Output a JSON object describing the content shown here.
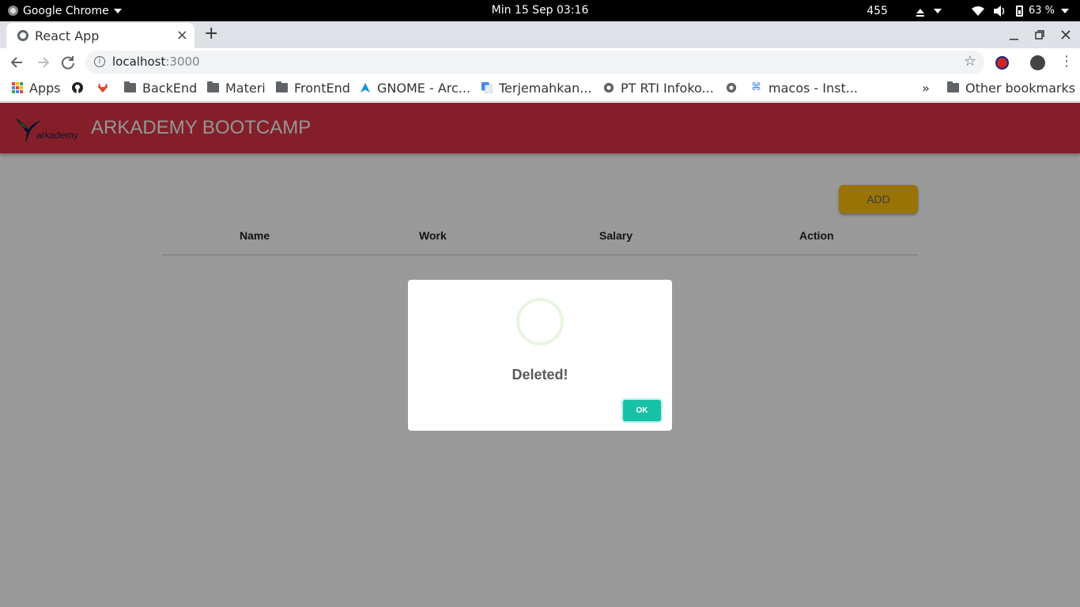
{
  "system_bar": {
    "app_name": "Google Chrome",
    "clock": "Min 15 Sep  03:16",
    "counter": "455",
    "battery": "63 %"
  },
  "browser": {
    "tab_title": "React App",
    "tab_close": "×",
    "new_tab": "+",
    "url_host": "localhost",
    "url_port": ":3000",
    "bookmarks": [
      {
        "label": "Apps",
        "icon": "apps-grid-icon"
      },
      {
        "label": "",
        "icon": "github-icon"
      },
      {
        "label": "",
        "icon": "gitlab-icon"
      },
      {
        "label": "BackEnd",
        "icon": "folder-icon"
      },
      {
        "label": "Materi",
        "icon": "folder-icon"
      },
      {
        "label": "FrontEnd",
        "icon": "folder-icon"
      },
      {
        "label": "GNOME - Arc...",
        "icon": "arch-icon"
      },
      {
        "label": "Terjemahkan...",
        "icon": "translate-icon"
      },
      {
        "label": "PT RTI Infoko...",
        "icon": "globe-icon"
      },
      {
        "label": "",
        "icon": "globe-icon"
      },
      {
        "label": "macos - Inst...",
        "icon": "command-icon"
      }
    ],
    "overflow": "»",
    "other_bookmarks": "Other bookmarks"
  },
  "app": {
    "brand_word": "arkademy",
    "title": "ARKADEMY BOOTCAMP",
    "add_button": "ADD",
    "columns": [
      "Name",
      "Work",
      "Salary",
      "Action"
    ],
    "colors": {
      "appbar": "#dc3545",
      "add": "#ffc107",
      "ok": "#17c1a5"
    }
  },
  "dialog": {
    "message": "Deleted!",
    "ok_label": "OK"
  }
}
